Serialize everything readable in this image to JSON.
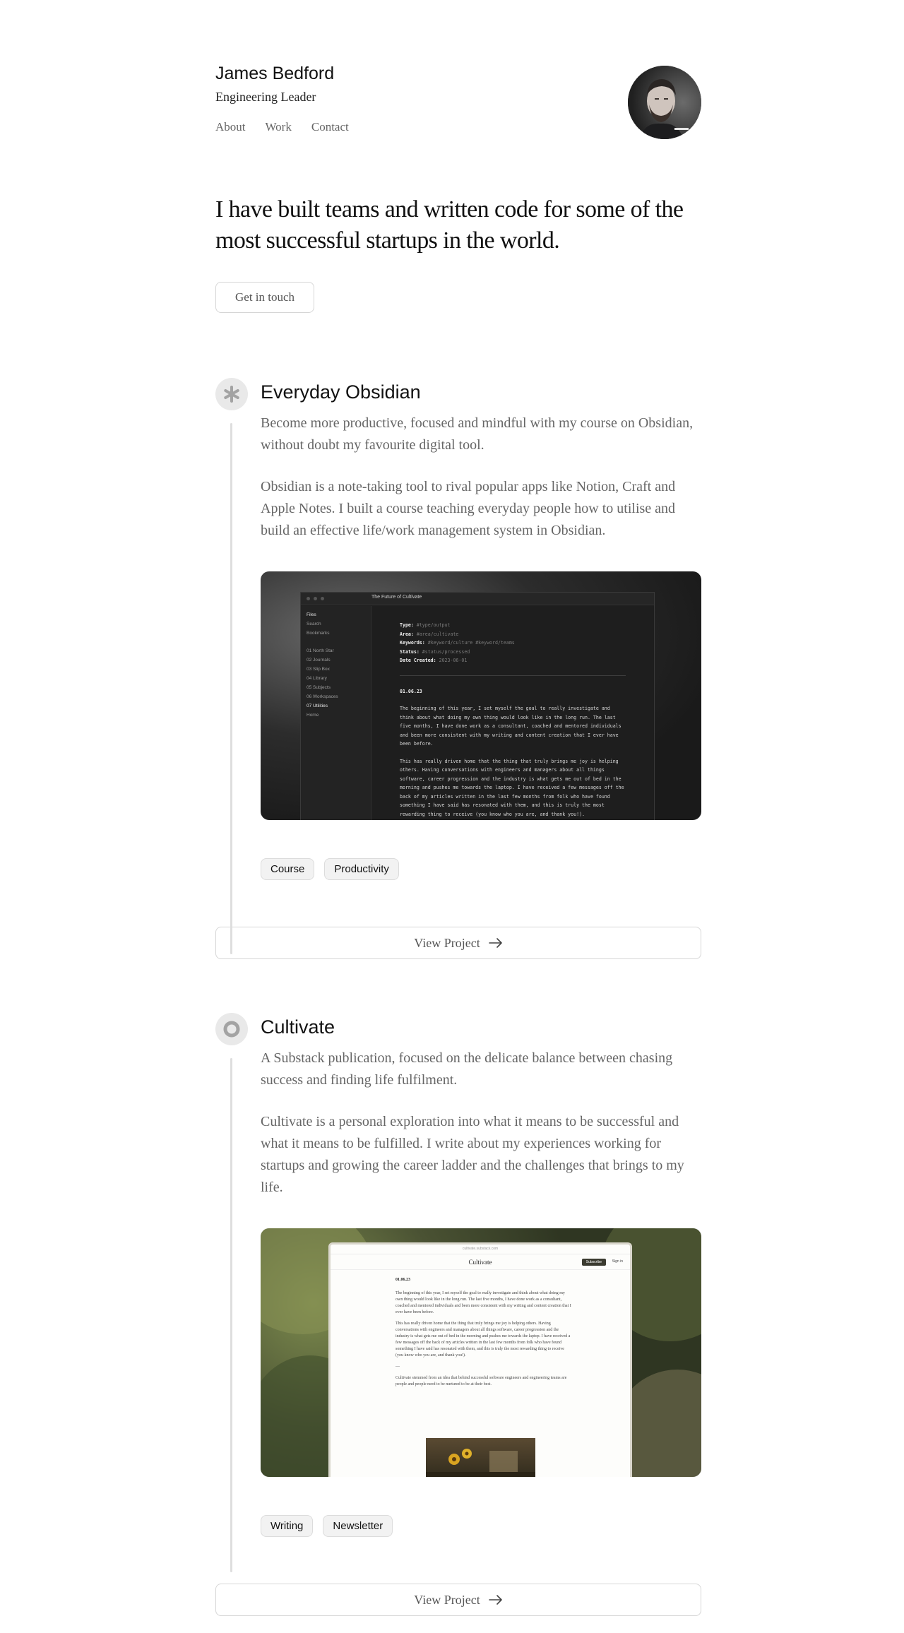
{
  "header": {
    "name": "James Bedford",
    "role": "Engineering Leader",
    "nav": [
      "About",
      "Work",
      "Contact"
    ]
  },
  "hero": {
    "headline": "I have built teams and written code for some of the most successful startups in the world.",
    "cta_label": "Get in touch"
  },
  "projects": [
    {
      "title": "Everyday Obsidian",
      "summary": "Become more productive, focused and mindful with my course on Obsidian, without doubt my favourite digital tool.",
      "description": "Obsidian is a note-taking tool to rival popular apps like Notion, Craft and Apple Notes. I built a course teaching everyday people how to utilise and build an effective life/work management system in Obsidian.",
      "tags": [
        "Course",
        "Productivity"
      ],
      "view_label": "View Project",
      "screenshot": {
        "tab_title": "The Future of Cultivate",
        "sidebar": [
          "Files",
          "Search",
          "Bookmarks",
          "01 North Star",
          "02 Journals",
          "03 Slip Box",
          "04 Library",
          "05 Subjects",
          "06 Workspaces",
          "07 Utilities",
          "Home"
        ],
        "meta": [
          {
            "key": "Type:",
            "value": "#type/output"
          },
          {
            "key": "Area:",
            "value": "#area/cultivate"
          },
          {
            "key": "Keywords:",
            "value": "#keyword/culture #keyword/teams"
          },
          {
            "key": "Status:",
            "value": "#status/processed"
          },
          {
            "key": "Date Created:",
            "value": "2023-06-01"
          }
        ],
        "date": "01.06.23",
        "para1": "The beginning of this year, I set myself the goal to really investigate and think about what doing my own thing would look like in the long run. The last five months, I have done work as a consultant, coached and mentored individuals and been more consistent with my writing and content creation that I ever have been before.",
        "para2": "This has really driven home that the thing that truly brings me joy is helping others. Having conversations with engineers and managers about all things software, career progression and the industry is what gets me out of bed in the morning and pushes me towards the laptop. I have received a few messages off the back of my articles written in the last few months from folk who have found something I have said has resonated with them, and this is truly the most rewarding thing to receive (you know who you are, and thank you!)."
      }
    },
    {
      "title": "Cultivate",
      "summary": "A Substack publication, focused on the delicate balance between chasing success and finding life fulfilment.",
      "description": "Cultivate is a personal exploration into what it means to be successful and what it means to be fulfilled. I write about my experiences working for startups and growing the career ladder and the challenges that brings to my life.",
      "tags": [
        "Writing",
        "Newsletter"
      ],
      "view_label": "View Project",
      "screenshot": {
        "url": "cultivate.substack.com",
        "pub_name": "Cultivate",
        "subscribe": "Subscribe",
        "sign_in": "Sign in",
        "date": "01.06.23",
        "para1": "The beginning of this year, I set myself the goal to really investigate and think about what doing my own thing would look like in the long run. The last five months, I have done work as a consultant, coached and mentored individuals and been more consistent with my writing and content creation that I ever have been before.",
        "para2": "This has really driven home that the thing that truly brings me joy is helping others. Having conversations with engineers and managers about all things software, career progression and the industry is what gets me out of bed in the morning and pushes me towards the laptop. I have received a few messages off the back of my articles written in the last few months from folk who have found something I have said has resonated with them, and this is truly the most rewarding thing to receive (you know who you are, and thank you!).",
        "sep": "—",
        "para3": "Cultivate stemmed from an idea that behind successful software engineers and engineering teams are people and people need to be nurtured to be at their best."
      }
    }
  ]
}
